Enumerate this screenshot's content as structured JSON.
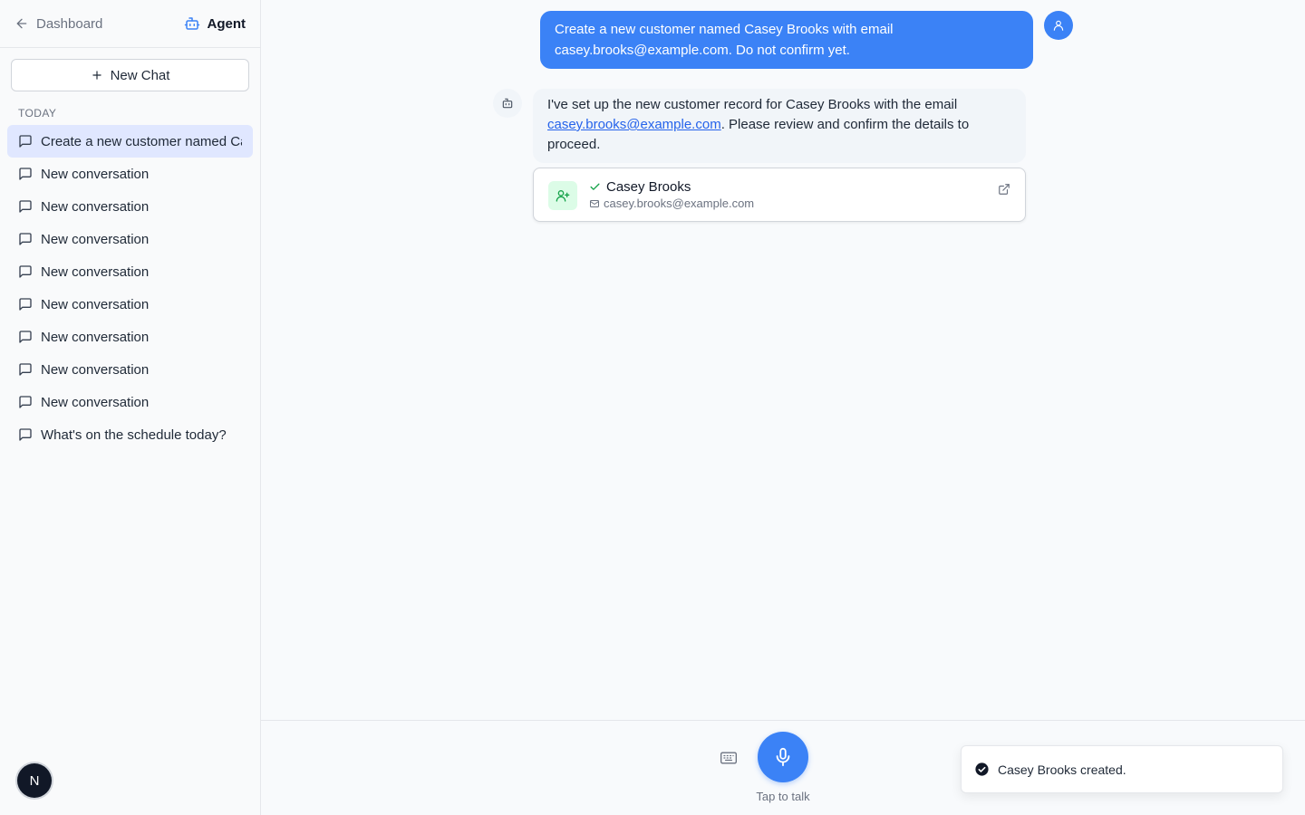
{
  "sidebar": {
    "back_label": "Dashboard",
    "agent_label": "Agent",
    "new_chat_label": "New Chat",
    "section_label": "TODAY",
    "conversations": [
      "Create a new customer named Casey Brooks with email casey.brooks@example.com. Do not confirm yet.",
      "New conversation",
      "New conversation",
      "New conversation",
      "New conversation",
      "New conversation",
      "New conversation",
      "New conversation",
      "New conversation",
      "What's on the schedule today?"
    ],
    "user_initial": "N"
  },
  "chat": {
    "user_message": "Create a new customer named Casey Brooks with email casey.brooks@example.com. Do not confirm yet.",
    "bot_message_prefix": "I've set up the new customer record for Casey Brooks with the email ",
    "bot_message_link": "casey.brooks@example.com",
    "bot_message_suffix": ". Please review and confirm the details to proceed.",
    "card": {
      "name": "Casey Brooks",
      "email": "casey.brooks@example.com"
    }
  },
  "input": {
    "tap_label": "Tap to talk"
  },
  "toast": {
    "message": "Casey Brooks created."
  },
  "colors": {
    "accent": "#3b82f6",
    "active_item": "#e0e7ff",
    "success": "#16a34a"
  }
}
